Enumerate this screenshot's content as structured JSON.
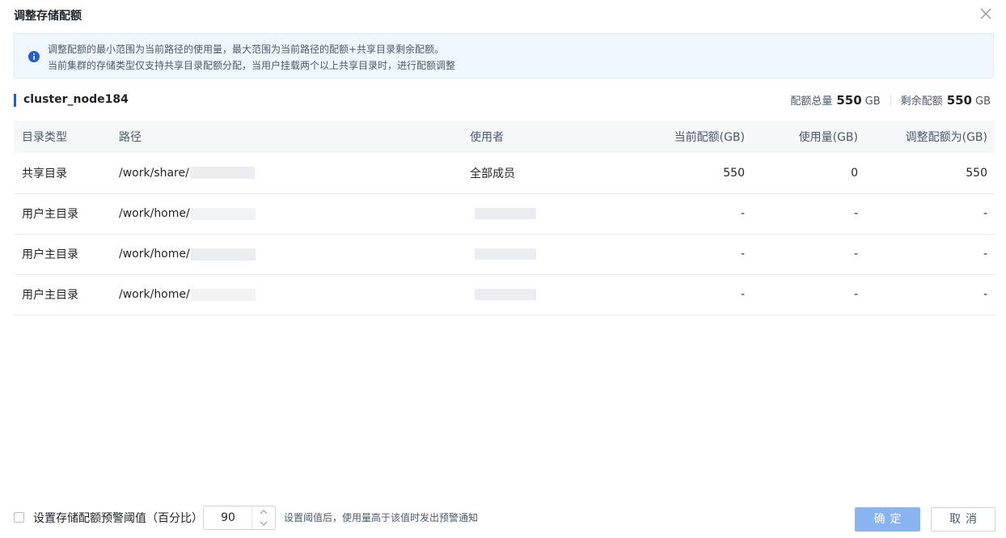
{
  "dialog": {
    "title": "调整存储配额"
  },
  "info": {
    "line1": "调整配额的最小范围为当前路径的使用量，最大范围为当前路径的配额+共享目录剩余配额。",
    "line2": "当前集群的存储类型仅支持共享目录配额分配，当用户挂载两个以上共享目录时，进行配额调整"
  },
  "cluster": {
    "name": "cluster_node184",
    "total_label": "配额总量",
    "total_value": "550",
    "total_unit": "GB",
    "remaining_label": "剩余配额",
    "remaining_value": "550",
    "remaining_unit": "GB"
  },
  "table": {
    "columns": [
      "目录类型",
      "路径",
      "使用者",
      "当前配额(GB)",
      "使用量(GB)",
      "调整配额为(GB)"
    ],
    "rows": [
      {
        "type": "共享目录",
        "path": "/work/share/",
        "user": "全部成员",
        "quota": "550",
        "usage": "0",
        "adjust": "550"
      },
      {
        "type": "用户主目录",
        "path": "/work/home/",
        "user": "",
        "quota": "-",
        "usage": "-",
        "adjust": "-"
      },
      {
        "type": "用户主目录",
        "path": "/work/home/",
        "user": "",
        "quota": "-",
        "usage": "-",
        "adjust": "-"
      },
      {
        "type": "用户主目录",
        "path": "/work/home/",
        "user": "",
        "quota": "-",
        "usage": "-",
        "adjust": "-"
      }
    ]
  },
  "footer": {
    "checkbox_label": "设置存储配额预警阈值（百分比）",
    "checkbox_checked": false,
    "threshold_value": "90",
    "hint": "设置阈值后，使用量高于该值时发出预警通知",
    "ok_label": "确定",
    "cancel_label": "取消"
  },
  "colors": {
    "accent": "#1f5ed6",
    "ok_button": "#8ab4f0",
    "info_bg": "#f0f7fe"
  },
  "icons": {
    "close": "close-icon",
    "info": "info-icon",
    "up": "chevron-up-icon",
    "down": "chevron-down-icon"
  }
}
